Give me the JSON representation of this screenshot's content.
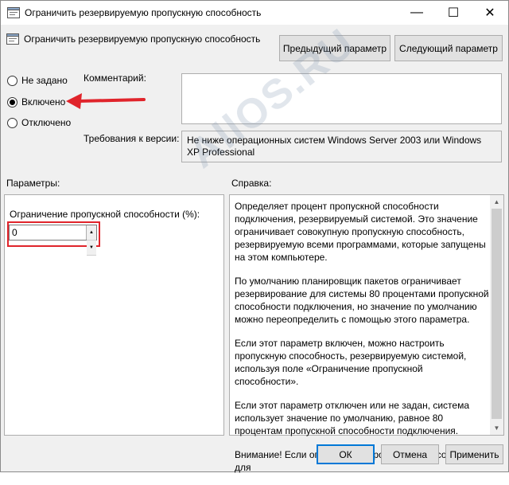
{
  "window": {
    "title": "Ограничить резервируемую пропускную способность",
    "minimize_glyph": "—",
    "maximize_glyph": "☐",
    "close_glyph": "✕"
  },
  "header": {
    "setting_title": "Ограничить резервируемую пропускную способность",
    "prev_button": "Предыдущий параметр",
    "next_button": "Следующий параметр"
  },
  "state": {
    "options": [
      {
        "label": "Не задано",
        "selected": false
      },
      {
        "label": "Включено",
        "selected": true
      },
      {
        "label": "Отключено",
        "selected": false
      }
    ]
  },
  "comment": {
    "label": "Комментарий:",
    "value": ""
  },
  "requirements": {
    "label": "Требования к версии:",
    "value": "Не ниже операционных систем Windows Server 2003 или Windows XP Professional"
  },
  "params": {
    "label": "Параметры:",
    "field_label": "Ограничение пропускной способности (%):",
    "value": "0"
  },
  "help": {
    "label": "Справка:",
    "paragraphs": [
      "Определяет процент пропускной способности подключения, резервируемый системой. Это значение ограничивает совокупную пропускную способность, резервируемую всеми программами, которые запущены на этом компьютере.",
      "По умолчанию планировщик пакетов ограничивает резервирование для системы 80 процентами пропускной способности подключения, но значение по умолчанию можно переопределить с помощью этого параметра.",
      "Если этот параметр включен, можно настроить пропускную способность, резервируемую системой, используя поле «Ограничение пропускной способности».",
      "Если этот параметр отключен или не задан, система использует значение по умолчанию, равное 80 процентам пропускной способности подключения.",
      "Внимание! Если ограничение пропускной способности для"
    ]
  },
  "footer": {
    "ok": "ОК",
    "cancel": "Отмена",
    "apply": "Применить"
  },
  "watermark": "AllOS.RU",
  "colors": {
    "annotation_red": "#e0242b",
    "focus_blue": "#0078d7"
  }
}
